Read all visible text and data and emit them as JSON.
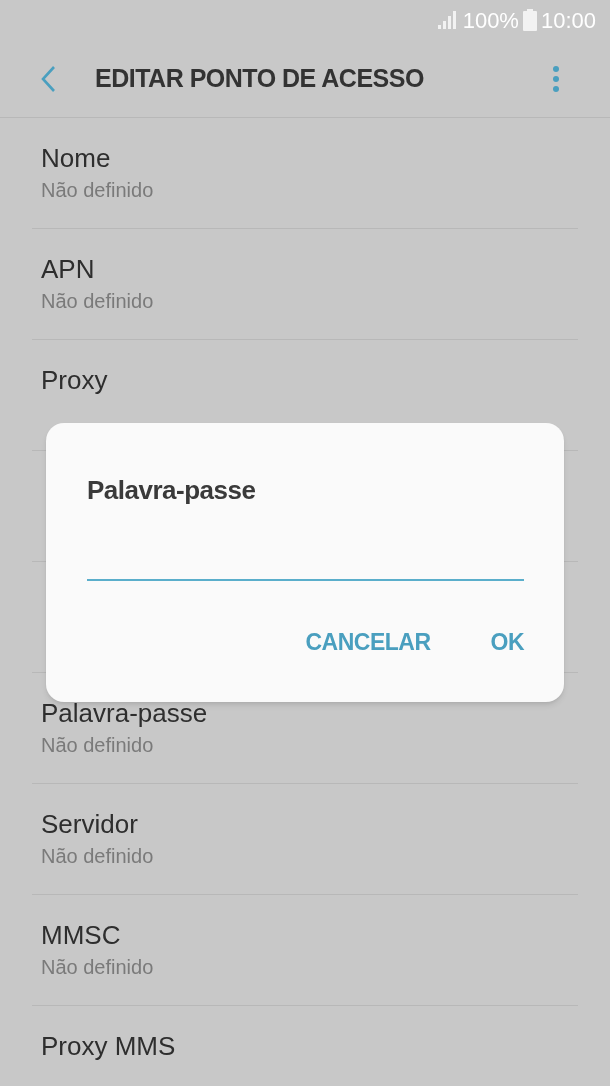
{
  "status_bar": {
    "battery": "100%",
    "time": "10:00"
  },
  "header": {
    "title": "EDITAR PONTO DE ACESSO"
  },
  "settings": [
    {
      "title": "Nome",
      "value": "Não definido"
    },
    {
      "title": "APN",
      "value": "Não definido"
    },
    {
      "title": "Proxy"
    },
    {
      "title": "Palavra-passe",
      "value": "Não definido"
    },
    {
      "title": "Servidor",
      "value": "Não definido"
    },
    {
      "title": "MMSC",
      "value": "Não definido"
    },
    {
      "title": "Proxy MMS"
    }
  ],
  "dialog": {
    "title": "Palavra-passe",
    "buttons": [
      "CANCELAR",
      "OK"
    ]
  }
}
